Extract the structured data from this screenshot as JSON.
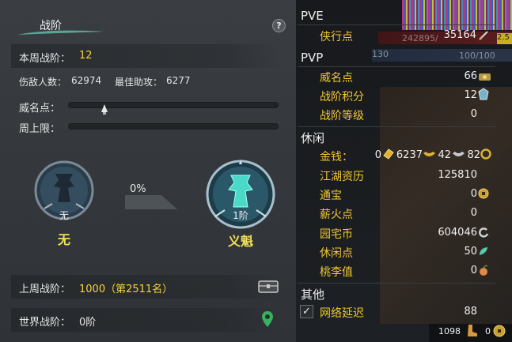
{
  "left": {
    "title": "战阶",
    "help": "?",
    "week_rank_label": "本周战阶：",
    "week_rank_value": "12",
    "damage_label": "伤敌人数：",
    "damage_value": "62974",
    "assist_label": "最佳助攻：",
    "assist_value": "6277",
    "prestige_label": "威名点：",
    "weekly_cap_label": "周上限：",
    "progress_percent": "0%",
    "current_medal": {
      "level": "无",
      "name": "无"
    },
    "next_medal": {
      "level": "1阶",
      "name": "义魁"
    },
    "last_week_label": "上周战阶：",
    "last_week_value": "1000（第2511名）",
    "world_label": "世界战阶：",
    "world_value": "0阶"
  },
  "right": {
    "hud": {
      "num1": "242895/",
      "num2": "100/100",
      "num3": "130",
      "yellow": "2.5"
    },
    "pve_header": "PVE",
    "pve_items": [
      {
        "label": "侠行点",
        "value": "35164"
      }
    ],
    "pvp_header": "PVP",
    "pvp_items": [
      {
        "label": "威名点",
        "value": "66"
      },
      {
        "label": "战阶积分",
        "value": "12"
      },
      {
        "label": "战阶等级",
        "value": "0"
      }
    ],
    "leisure_header": "休闲",
    "money": {
      "label": "金钱：",
      "brick": "0",
      "gold": "6237",
      "silver": "42",
      "copper": "82"
    },
    "leisure_items": [
      {
        "label": "江湖资历",
        "value": "125810"
      },
      {
        "label": "通宝",
        "value": "0"
      },
      {
        "label": "薪火点",
        "value": "0"
      },
      {
        "label": "园宅币",
        "value": "604046"
      },
      {
        "label": "休闲点",
        "value": "50"
      },
      {
        "label": "桃李值",
        "value": "0"
      }
    ],
    "other_header": "其他",
    "net": {
      "label": "网络延迟",
      "value": "88",
      "checked": "✓"
    },
    "bottom": {
      "left_value": "1098",
      "right_value": "0"
    }
  }
}
